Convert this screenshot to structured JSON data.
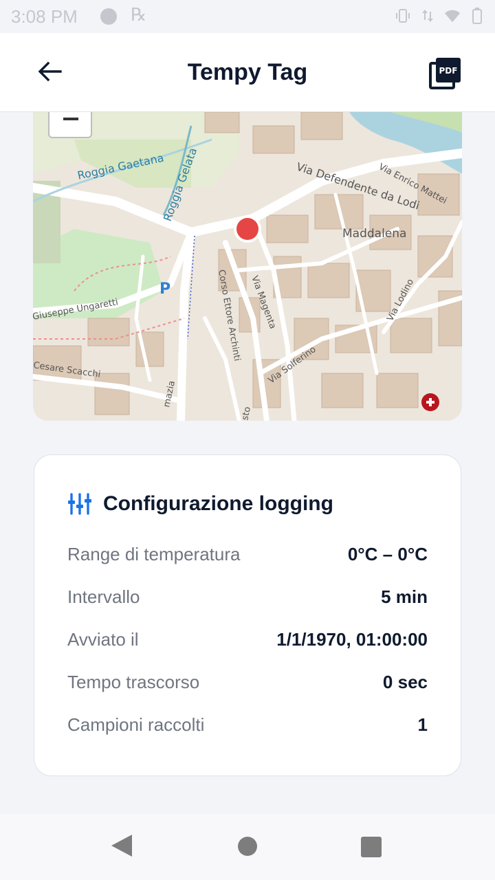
{
  "status_bar": {
    "time": "3:08 PM",
    "rx": "℞"
  },
  "app_bar": {
    "title": "Tempy Tag",
    "back_icon": "arrow-left-icon",
    "pdf_icon": "pdf-icon",
    "pdf_badge": "PDF"
  },
  "map": {
    "labels": {
      "roggia_gaetana": "Roggia Gaetana",
      "roggia_gelata": "Roggia Gelata",
      "via_defendente": "Via Defendente da Lodi",
      "via_enrico": "Via Enrico Mattei",
      "maddalena": "Maddalena",
      "giuseppe": "Giuseppe Ungaretti",
      "corso_ettore": "Corso Ettore Archinti",
      "via_magenta": "Via Magenta",
      "via_solferino": "Via Solferino",
      "via_lodino": "Via Lodino",
      "cesare_scacchi": "Cesare Scacchi",
      "parking": "P",
      "mazia": "mazia",
      "sto": "sto"
    },
    "marker_color": "#e64545"
  },
  "card": {
    "icon": "sliders-icon",
    "title": "Configurazione logging",
    "rows": [
      {
        "label": "Range di temperatura",
        "value": "0°C – 0°C"
      },
      {
        "label": "Intervallo",
        "value": "5 min"
      },
      {
        "label": "Avviato il",
        "value": "1/1/1970, 01:00:00"
      },
      {
        "label": "Tempo trascorso",
        "value": "0 sec"
      },
      {
        "label": "Campioni raccolti",
        "value": "1"
      }
    ]
  },
  "colors": {
    "accent": "#1a73e8",
    "title": "#0f1a2e",
    "label": "#6f7580"
  }
}
